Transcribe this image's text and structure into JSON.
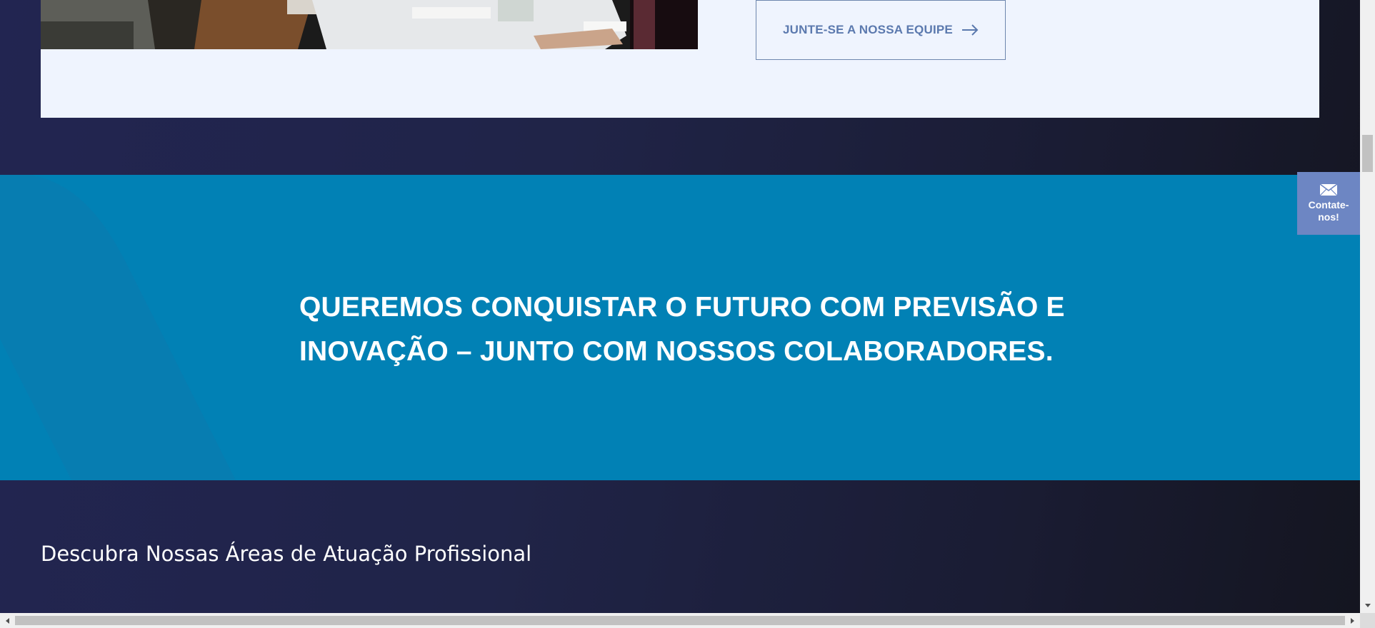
{
  "join_button": {
    "label": "JUNTE-SE A NOSSA EQUIPE",
    "icon": "arrow-right-icon"
  },
  "banner": {
    "headline": "QUEREMOS CONQUISTAR O FUTURO COM PREVISÃO E INOVAÇÃO – JUNTO COM NOSSOS COLABORADORES."
  },
  "section": {
    "title": "Descubra Nossas Áreas de Atuação Profissional"
  },
  "contact_tab": {
    "label": "Contate-nos!",
    "icon": "mail-icon"
  },
  "colors": {
    "page_background": "#202448",
    "card_background": "#eff4fe",
    "banner_blue": "#0181b5",
    "button_text": "#5b79ae",
    "contact_tab": "#6d86c3"
  }
}
